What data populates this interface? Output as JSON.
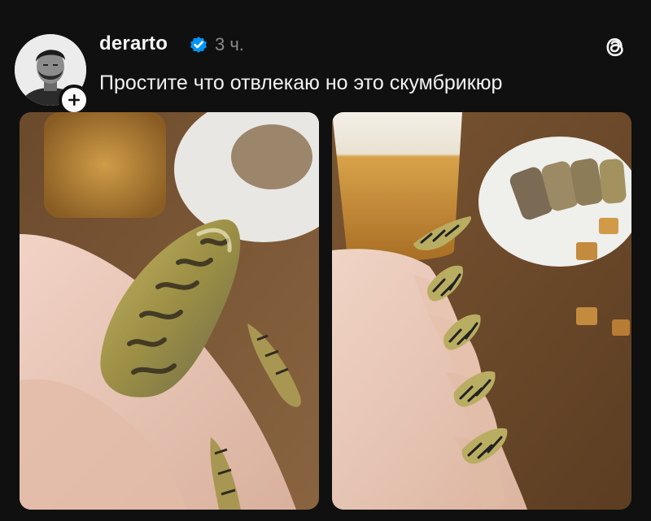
{
  "post": {
    "username": "derarto",
    "verified": true,
    "time_ago": "3 ч.",
    "text": "Простите что отвлекаю но это скумбрикюр",
    "follow_badge": "+"
  },
  "icons": {
    "verified": "verified-badge-icon",
    "follow": "plus-icon",
    "app": "threads-logo-icon"
  },
  "colors": {
    "background": "#101010",
    "text_primary": "#f3f3f3",
    "text_secondary": "#8a8a8a",
    "verified_blue": "#0095f6"
  },
  "media": [
    {
      "alt": "close-up-mackerel-nail-photo"
    },
    {
      "alt": "hand-with-mackerel-nails-photo"
    }
  ]
}
